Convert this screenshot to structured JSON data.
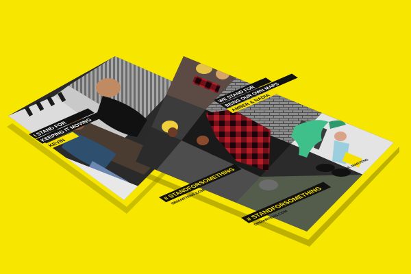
{
  "posters": {
    "back": {
      "caption_line1": "I STAND FOR",
      "caption_line2": "KEEPING IT MOVING",
      "name_tag": "KEVIN",
      "hashtag": "# STANDFORSOMETHING",
      "url": "DRMARTENS.COM"
    },
    "front": {
      "caption_line1": "WE STAND FOR",
      "caption_line2": "BEING OUR OWN MAPS",
      "name_tag": "AMBER & NADIA",
      "hashtag": "# STANDFORSOMETHING",
      "url": "DRMARTENS.COM",
      "badge": "DR. MARTENS"
    }
  },
  "colors": {
    "background": "#f7e600",
    "accent_yellow": "#f5e000",
    "plaid_red": "#c0202a",
    "plaid_dark": "#3a0a0e",
    "gator_green": "#3fbf8a"
  }
}
